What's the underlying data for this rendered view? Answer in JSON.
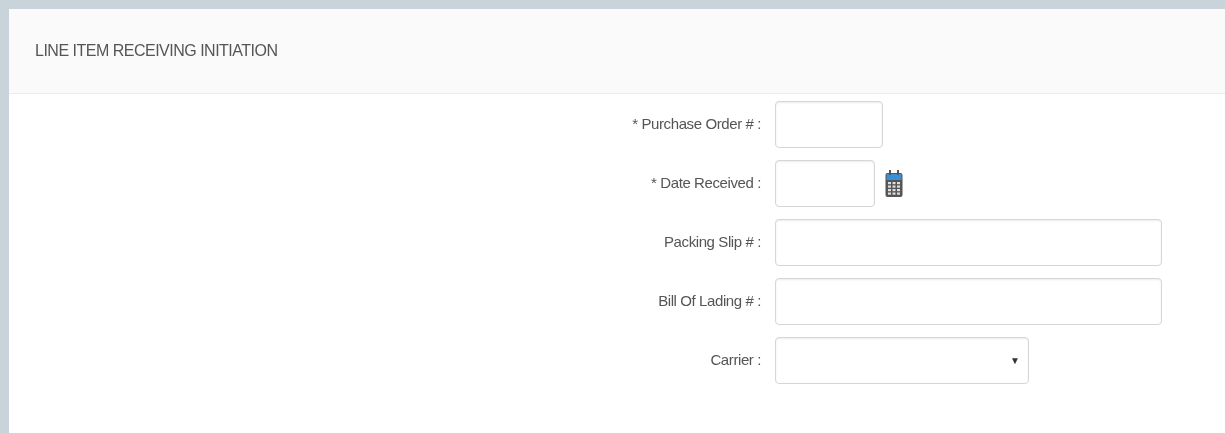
{
  "panel": {
    "title": "LINE ITEM RECEIVING INITIATION"
  },
  "fields": [
    {
      "kind": "number",
      "label": "* Purchase Order # :"
    },
    {
      "kind": "date",
      "label": "* Date Received :"
    },
    {
      "kind": "text",
      "label": "Packing Slip # :"
    },
    {
      "kind": "text",
      "label": "Bill Of Lading # :"
    },
    {
      "kind": "select",
      "label": "Carrier :",
      "arrow": "▼"
    }
  ]
}
